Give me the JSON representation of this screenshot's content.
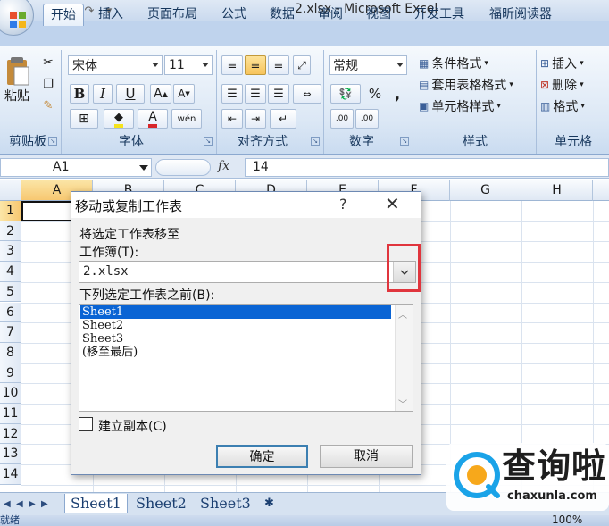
{
  "window": {
    "title": "2.xlsx - Microsoft Excel"
  },
  "tabs": [
    "开始",
    "插入",
    "页面布局",
    "公式",
    "数据",
    "审阅",
    "视图",
    "开发工具",
    "福昕阅读器"
  ],
  "ribbon": {
    "clipboard": {
      "label": "剪贴板",
      "paste": "粘贴"
    },
    "font": {
      "label": "字体",
      "name": "宋体",
      "size": "11",
      "bold": "B",
      "italic": "I",
      "underline": "U"
    },
    "alignment": {
      "label": "对齐方式"
    },
    "number": {
      "label": "数字",
      "format": "常规",
      "percent": "%",
      "comma": ",",
      "inc_decimal": ".00",
      "dec_decimal": ".00"
    },
    "styles": {
      "label": "样式",
      "conditional": "条件格式",
      "table": "套用表格格式",
      "cell": "单元格样式"
    },
    "cells": {
      "label": "单元格",
      "insert": "插入",
      "delete": "删除",
      "format": "格式"
    }
  },
  "formula_bar": {
    "name_box": "A1",
    "fx": "fx",
    "value": "14"
  },
  "grid": {
    "columns": [
      "A",
      "B",
      "C",
      "D",
      "E",
      "F",
      "G",
      "H"
    ],
    "rows": [
      "1",
      "2",
      "3",
      "4",
      "5",
      "6",
      "7",
      "8",
      "9",
      "10",
      "11",
      "12",
      "13",
      "14"
    ]
  },
  "sheet_tabs": [
    "Sheet1",
    "Sheet2",
    "Sheet3"
  ],
  "status": {
    "ready": "就绪",
    "zoom": "100%"
  },
  "dialog": {
    "title": "移动或复制工作表",
    "help": "?",
    "close": "✕",
    "move_to_label": "将选定工作表移至",
    "workbook_label": "工作簿(T):",
    "workbook_value": "2.xlsx",
    "before_label": "下列选定工作表之前(B):",
    "list": [
      "Sheet1",
      "Sheet2",
      "Sheet3",
      "(移至最后)"
    ],
    "copy_label": "建立副本(C)",
    "ok": "确定",
    "cancel": "取消"
  },
  "watermark": {
    "text": "查询啦",
    "url": "chaxunla.com"
  }
}
